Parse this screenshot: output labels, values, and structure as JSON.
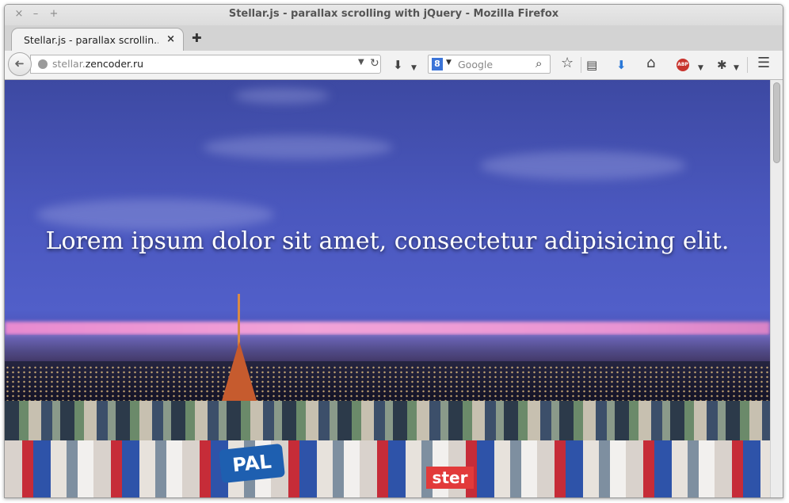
{
  "window": {
    "title": "Stellar.js - parallax scrolling with jQuery - Mozilla Firefox",
    "close_glyph": "×",
    "minimize_glyph": "–",
    "maximize_glyph": "+"
  },
  "tabs": [
    {
      "label": "Stellar.js - parallax scrollin...",
      "close_glyph": "×",
      "active": true
    }
  ],
  "new_tab_glyph": "✚",
  "navbar": {
    "back_glyph": "➜",
    "url_prefix": "stellar.",
    "url_domain": "zencoder.ru",
    "url_dropdown_glyph": "▼",
    "reload_glyph": "↻",
    "search_engine_letter": "8",
    "search_dropdown_glyph": "▼",
    "search_placeholder": "Google",
    "search_glyph": "⌕",
    "bookmark_glyph": "☆",
    "reader_glyph": "▤",
    "download_glyph": "⬇",
    "home_glyph": "⌂",
    "abp_label": "ABP",
    "dropdown_glyph": "▼",
    "menu_glyph": "☰"
  },
  "page": {
    "hero_text": "Lorem ipsum dolor sit amet, consectetur adipisicing elit.",
    "sign_pal": "PAL",
    "sign_ester": "ster"
  },
  "colors": {
    "sky": "#4a57bd",
    "pink_horizon": "#f2a3d8",
    "tower": "#c65b2e"
  }
}
